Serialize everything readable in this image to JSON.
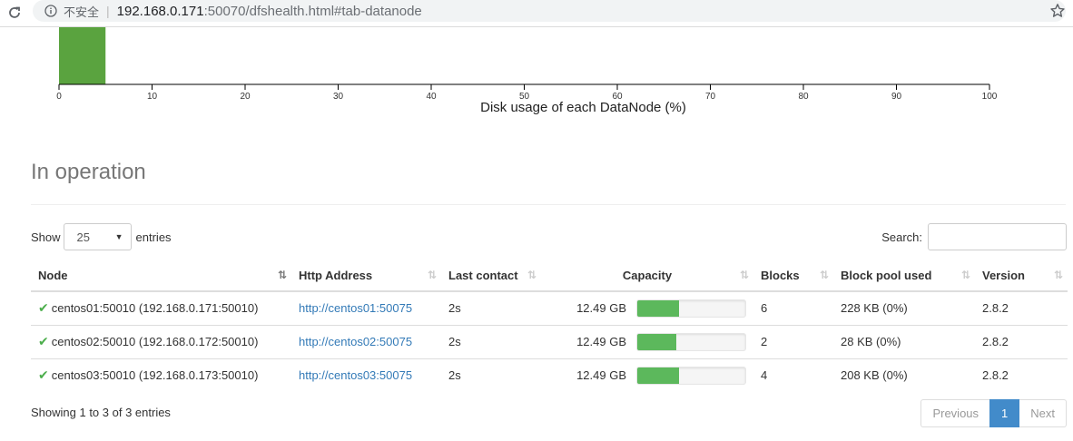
{
  "browser": {
    "security_label": "不安全",
    "separator": "|",
    "url_host": "192.168.0.171",
    "url_rest": ":50070/dfshealth.html#tab-datanode"
  },
  "chart_data": {
    "type": "bar",
    "xlabel": "Disk usage of each DataNode (%)",
    "xlim": [
      0,
      100
    ],
    "x_ticks": [
      "0",
      "10",
      "20",
      "30",
      "40",
      "50",
      "60",
      "70",
      "80",
      "90",
      "100"
    ],
    "bins": [
      {
        "start": 0,
        "end": 5,
        "value": 3
      }
    ],
    "color": "#5aa33f"
  },
  "section": {
    "title": "In operation"
  },
  "controls": {
    "show_label": "Show",
    "page_length": "25",
    "entries_label": "entries",
    "search_label": "Search:",
    "search_value": ""
  },
  "table": {
    "headers": [
      "Node",
      "Http Address",
      "Last contact",
      "Capacity",
      "Blocks",
      "Block pool used",
      "Version"
    ],
    "rows": [
      {
        "node": "centos01:50010 (192.168.0.171:50010)",
        "http": "http://centos01:50075",
        "last_contact": "2s",
        "capacity": "12.49 GB",
        "usage_fraction": 0.39,
        "blocks": "6",
        "block_pool_used": "228 KB (0%)",
        "version": "2.8.2"
      },
      {
        "node": "centos02:50010 (192.168.0.172:50010)",
        "http": "http://centos02:50075",
        "last_contact": "2s",
        "capacity": "12.49 GB",
        "usage_fraction": 0.36,
        "blocks": "2",
        "block_pool_used": "28 KB (0%)",
        "version": "2.8.2"
      },
      {
        "node": "centos03:50010 (192.168.0.173:50010)",
        "http": "http://centos03:50075",
        "last_contact": "2s",
        "capacity": "12.49 GB",
        "usage_fraction": 0.39,
        "blocks": "4",
        "block_pool_used": "208 KB (0%)",
        "version": "2.8.2"
      }
    ]
  },
  "footer": {
    "info": "Showing 1 to 3 of 3 entries",
    "previous": "Previous",
    "current_page": "1",
    "next": "Next"
  },
  "colors": {
    "accent": "#428bca",
    "link": "#337ab7",
    "progress": "#5cb85c",
    "check": "#4cae4c"
  }
}
